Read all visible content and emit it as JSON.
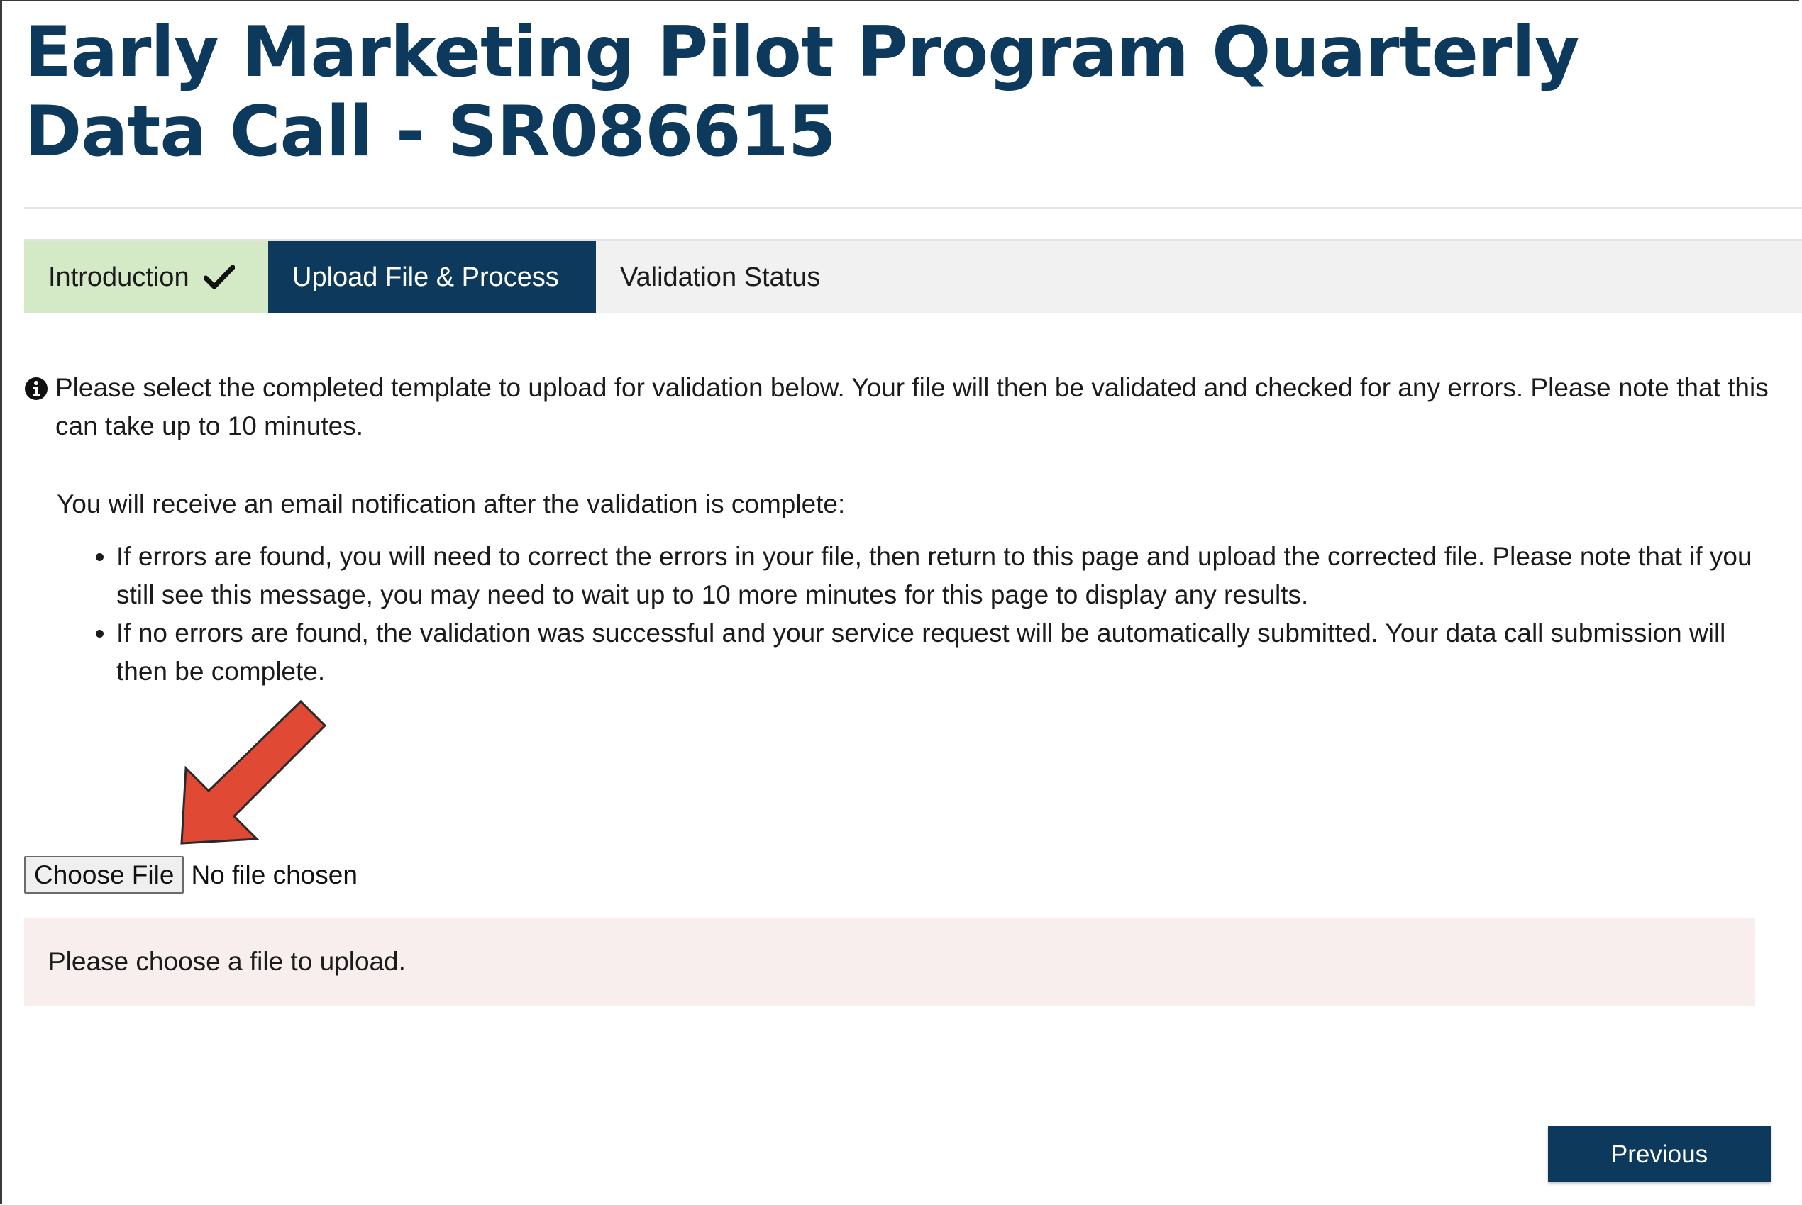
{
  "page": {
    "title": "Early Marketing Pilot Program Quarterly Data Call - SR086615"
  },
  "tabs": [
    {
      "label": "Introduction",
      "state": "complete",
      "icon": "check-icon"
    },
    {
      "label": "Upload File & Process",
      "state": "active"
    },
    {
      "label": "Validation Status",
      "state": "pending"
    }
  ],
  "instructions": {
    "info_icon": "info-circle-icon",
    "intro": "Please select the completed template to upload for validation below. Your file will then be validated and checked for any errors. Please note that this can take up to 10 minutes.",
    "email_note": "You will receive an email notification after the validation is complete:",
    "bullets": [
      "If errors are found, you will need to correct the errors in your file, then return to this page and upload the corrected file. Please note that if you still see this message, you may need to wait up to 10 more minutes for this page to display any results.",
      "If no errors are found, the validation was successful and your service request will be automatically submitted. Your data call submission will then be complete."
    ]
  },
  "file_input": {
    "button_label": "Choose File",
    "status": "No file chosen"
  },
  "alert": {
    "message": "Please choose a file to upload."
  },
  "navigation": {
    "previous_label": "Previous"
  },
  "colors": {
    "brand_navy": "#0d3a5c",
    "complete_green": "#d4eac6",
    "alert_bg": "#f8eeee",
    "annotation_arrow": "#e04a35"
  }
}
